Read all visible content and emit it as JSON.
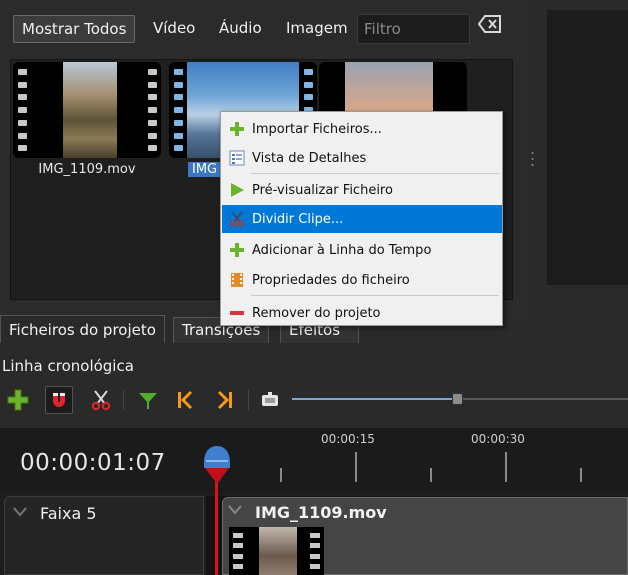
{
  "filter_bar": {
    "show_all": "Mostrar Todos",
    "video": "Vídeo",
    "audio": "Áudio",
    "image": "Imagem",
    "filter_placeholder": "Filtro"
  },
  "files": [
    {
      "label": "IMG_1109.mov"
    },
    {
      "label": "IMG"
    },
    {
      "label": ""
    }
  ],
  "tabs": {
    "project_files": "Ficheiros do projeto",
    "transitions": "Transições",
    "effects": "Efeitos"
  },
  "timeline": {
    "title": "Linha cronológica",
    "timecode": "00:00:01:07",
    "ruler_labels": [
      "00:00:15",
      "00:00:30"
    ],
    "zoom_level": 0.5,
    "track_name": "Faixa 5",
    "clip_name": "IMG_1109.mov"
  },
  "context_menu": {
    "items": [
      {
        "label": "Importar Ficheiros...",
        "icon": "plus-icon"
      },
      {
        "label": "Vista de Detalhes",
        "icon": "details-view-icon"
      },
      {
        "label": "Pré-visualizar Ficheiro",
        "icon": "play-icon"
      },
      {
        "label": "Dividir Clipe...",
        "icon": "scissors-icon"
      },
      {
        "label": "Adicionar à Linha do Tempo",
        "icon": "plus-icon"
      },
      {
        "label": "Propriedades do ficheiro",
        "icon": "film-properties-icon"
      },
      {
        "label": "Remover do projeto",
        "icon": "remove-icon"
      }
    ],
    "highlighted_index": 3
  },
  "colors": {
    "highlight": "#0078d7",
    "playhead": "#e0101a",
    "accent_green": "#6ab42d",
    "accent_orange": "#f39a1c"
  }
}
